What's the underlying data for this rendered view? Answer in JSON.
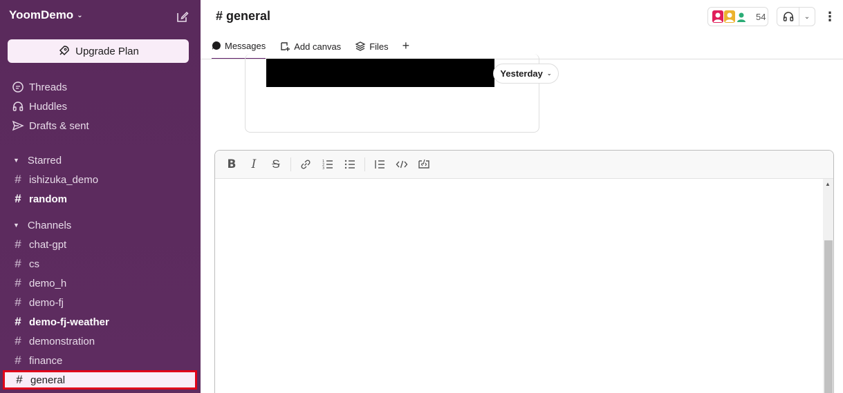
{
  "workspace": {
    "name": "YoomDemo"
  },
  "sidebar": {
    "upgrade_label": "Upgrade Plan",
    "top_items": [
      {
        "label": "Threads",
        "icon": "threads-icon"
      },
      {
        "label": "Huddles",
        "icon": "headphones-icon"
      },
      {
        "label": "Drafts & sent",
        "icon": "send-icon"
      }
    ],
    "starred": {
      "label": "Starred",
      "channels": [
        {
          "label": "ishizuka_demo",
          "bold": false
        },
        {
          "label": "random",
          "bold": true
        }
      ]
    },
    "channels": {
      "label": "Channels",
      "items": [
        {
          "label": "chat-gpt",
          "bold": false
        },
        {
          "label": "cs",
          "bold": false
        },
        {
          "label": "demo_h",
          "bold": false
        },
        {
          "label": "demo-fj",
          "bold": false
        },
        {
          "label": "demo-fj-weather",
          "bold": true
        },
        {
          "label": "demonstration",
          "bold": false
        },
        {
          "label": "finance",
          "bold": false
        },
        {
          "label": "general",
          "bold": false,
          "selected": true
        }
      ]
    },
    "hash": "#"
  },
  "header": {
    "channel_title": "# general",
    "member_count": "54"
  },
  "tabs": [
    {
      "label": "Messages",
      "active": true
    },
    {
      "label": "Add canvas"
    },
    {
      "label": "Files"
    }
  ],
  "messages": {
    "date_divider": "Yesterday"
  },
  "colors": {
    "sidebar_bg": "#5a2a5c",
    "accent": "#611f69",
    "selected_outline": "#e0001a"
  }
}
